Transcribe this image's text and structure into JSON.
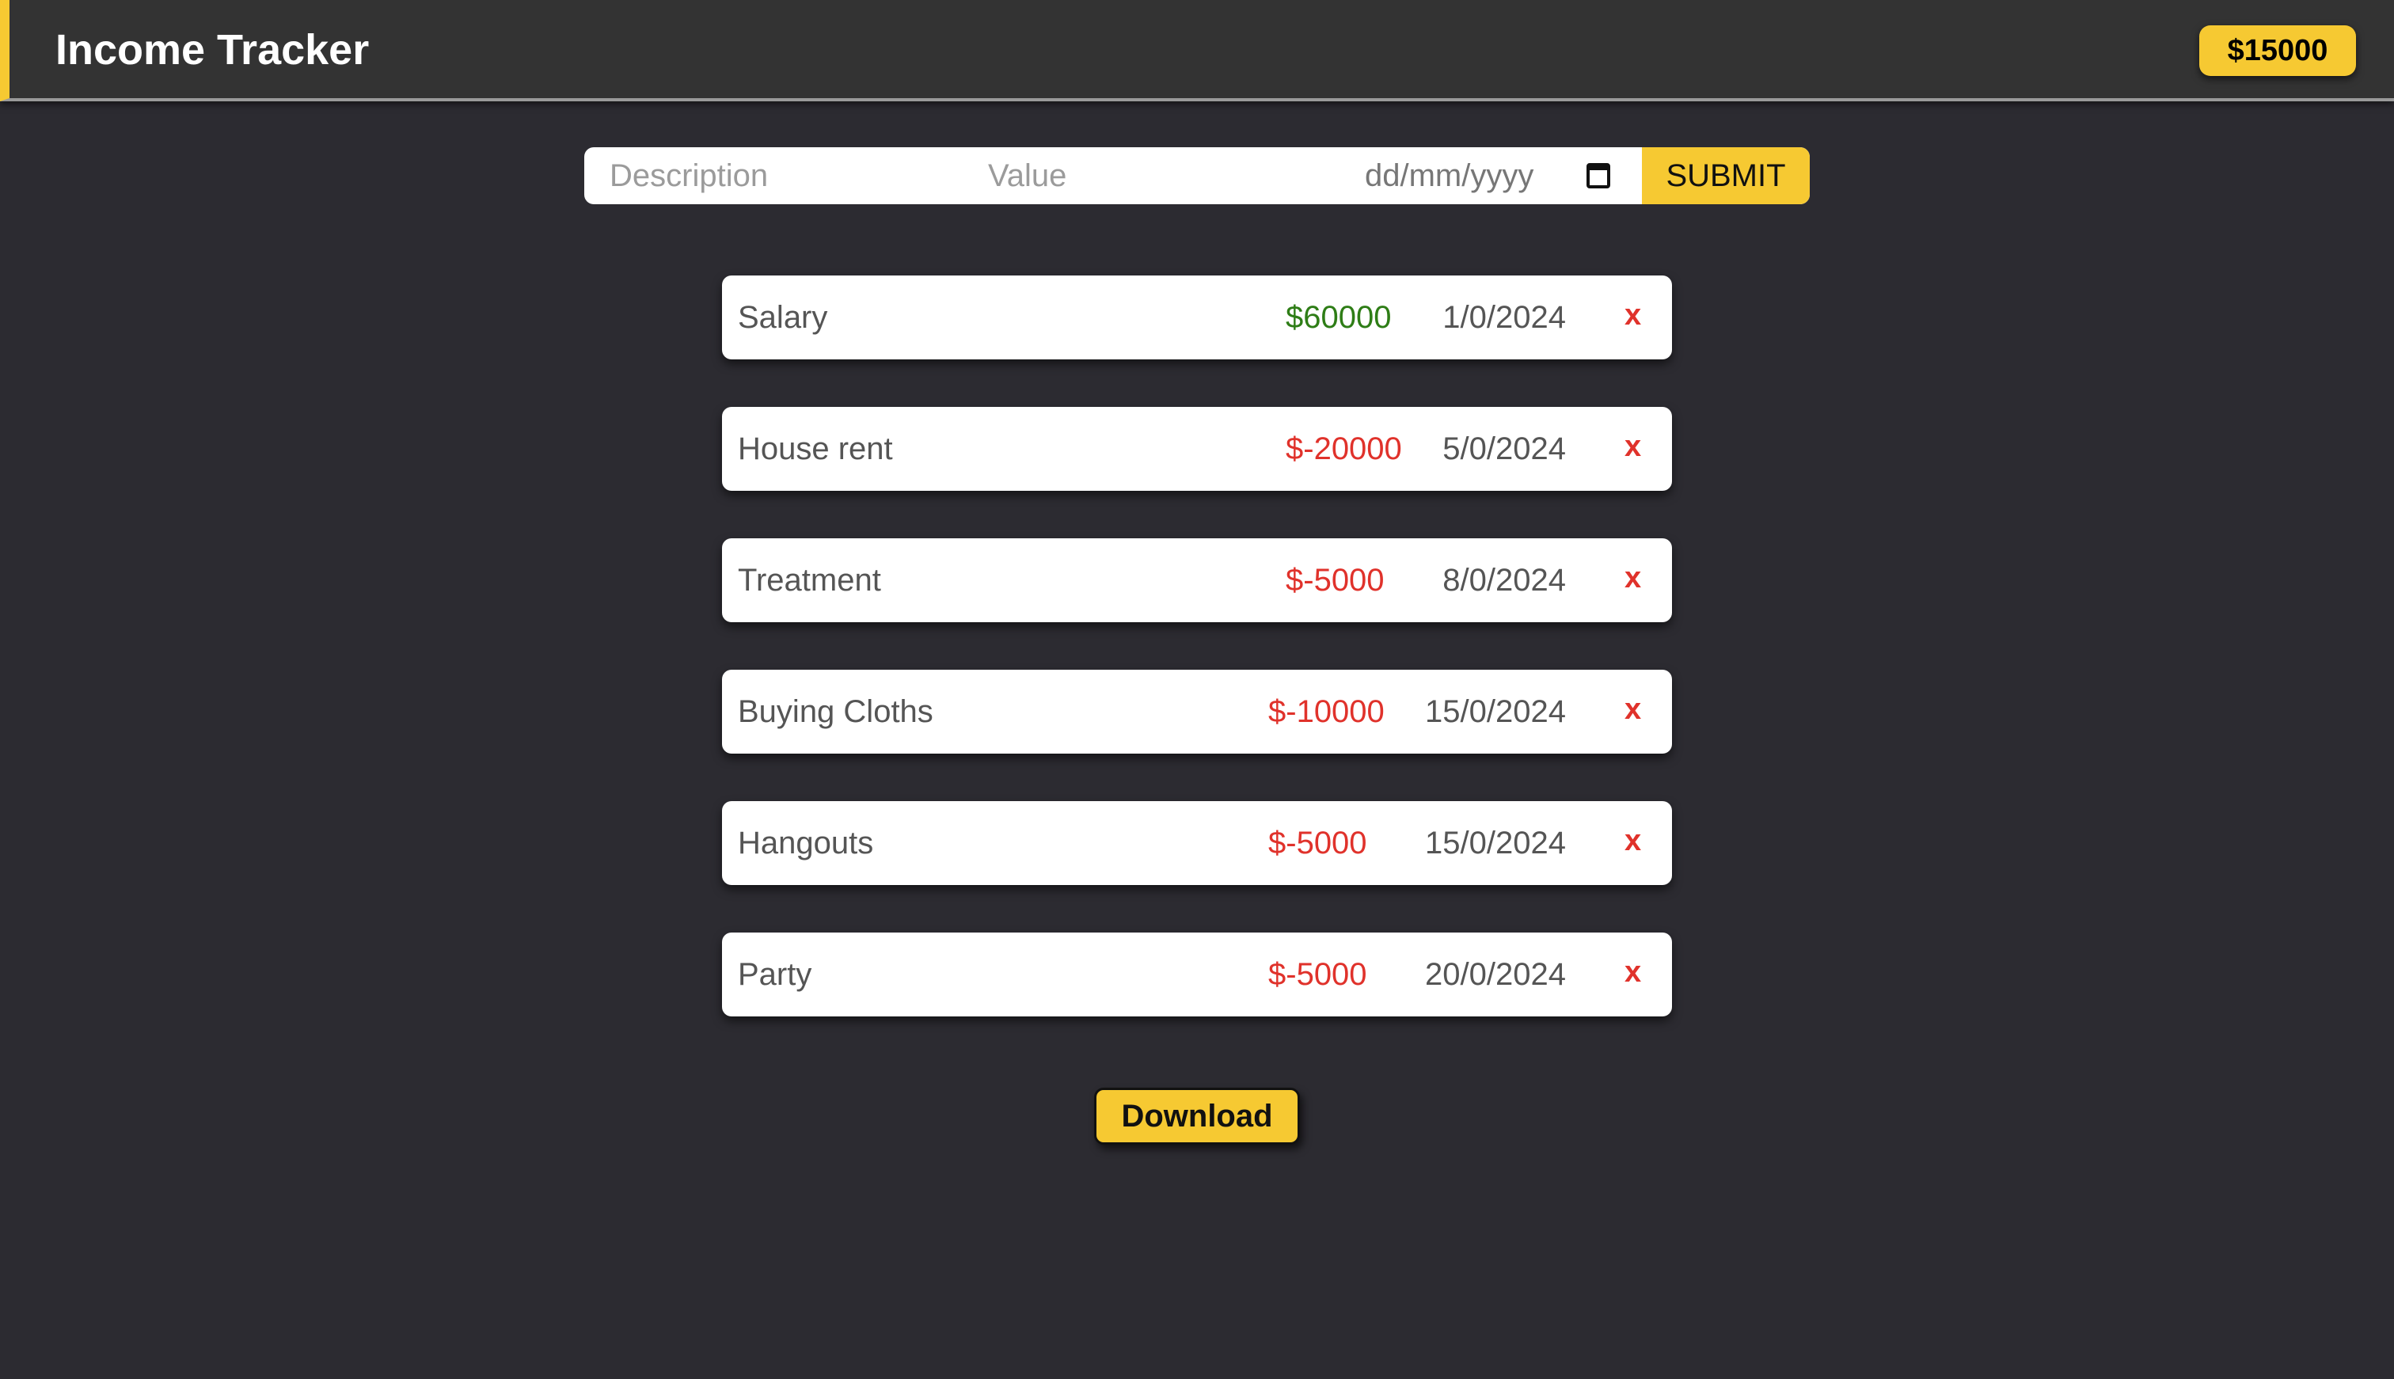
{
  "header": {
    "title": "Income Tracker",
    "balance": "$15000"
  },
  "form": {
    "description_placeholder": "Description",
    "value_placeholder": "Value",
    "date_placeholder": "dd/mm/yyyy",
    "submit_label": "SUBMIT"
  },
  "colors": {
    "accent": "#f6c932",
    "income": "#2e7d16",
    "expense": "#e0322b",
    "background": "#2c2b31"
  },
  "transactions": [
    {
      "description": "Salary",
      "amount": "$60000",
      "date": "1/0/2024",
      "type": "income",
      "delete": "x"
    },
    {
      "description": "House rent",
      "amount": "$-20000",
      "date": "5/0/2024",
      "type": "expense",
      "delete": "x"
    },
    {
      "description": "Treatment",
      "amount": "$-5000",
      "date": "8/0/2024",
      "type": "expense",
      "delete": "x"
    },
    {
      "description": "Buying Cloths",
      "amount": "$-10000",
      "date": "15/0/2024",
      "type": "expense",
      "delete": "x"
    },
    {
      "description": "Hangouts",
      "amount": "$-5000",
      "date": "15/0/2024",
      "type": "expense",
      "delete": "x"
    },
    {
      "description": "Party",
      "amount": "$-5000",
      "date": "20/0/2024",
      "type": "expense",
      "delete": "x"
    }
  ],
  "download_label": "Download"
}
